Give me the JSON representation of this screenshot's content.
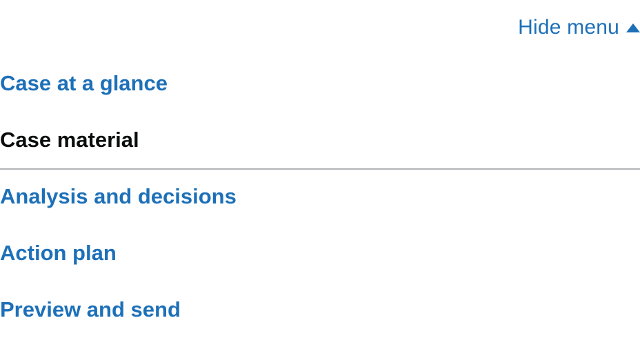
{
  "menu_toggle": {
    "label": "Hide menu",
    "icon": "caret-up-icon",
    "color": "#1d70b8"
  },
  "nav": {
    "items": [
      {
        "label": "Case at a glance",
        "current": false
      },
      {
        "label": "Case material",
        "current": true
      },
      {
        "label": "Analysis and decisions",
        "current": false
      },
      {
        "label": "Action plan",
        "current": false
      },
      {
        "label": "Preview and send",
        "current": false
      }
    ]
  },
  "colors": {
    "link": "#1d70b8",
    "text": "#0b0c0c",
    "divider": "#b1b4b6"
  }
}
